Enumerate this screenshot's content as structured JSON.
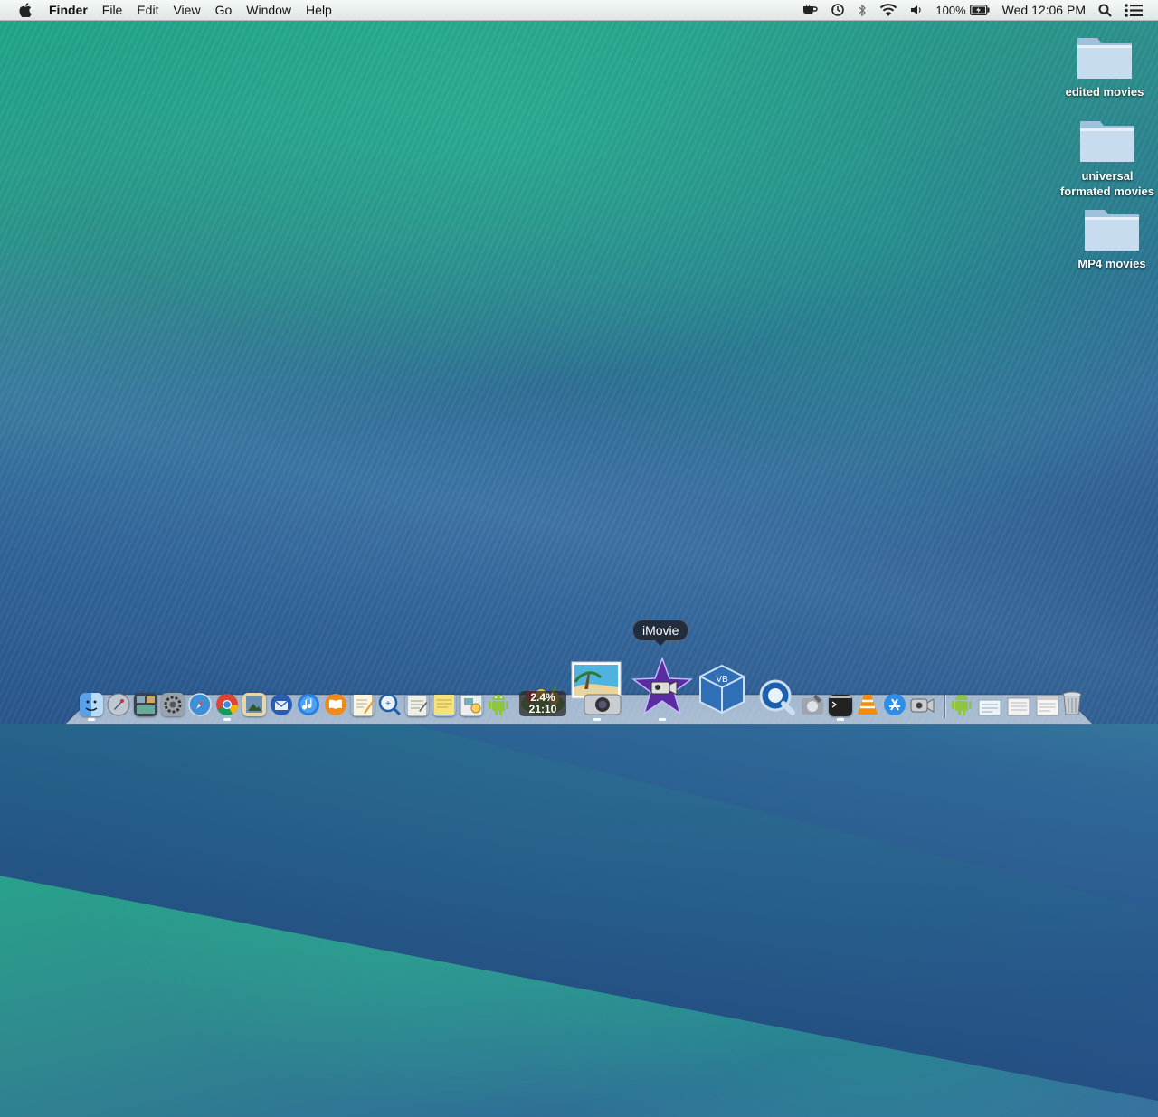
{
  "menubar": {
    "app_name": "Finder",
    "menus": [
      "File",
      "Edit",
      "View",
      "Go",
      "Window",
      "Help"
    ],
    "status": {
      "battery_percent": "100%",
      "clock": "Wed 12:06 PM"
    }
  },
  "desktop": {
    "folders": [
      {
        "label": "edited movies"
      },
      {
        "label": "universal\nformated movies"
      },
      {
        "label": "MP4 movies"
      }
    ]
  },
  "dock": {
    "tooltip": "iMovie",
    "cpu_monitor": {
      "percent": "2.4%",
      "time": "21:10"
    },
    "apps": [
      {
        "name": "finder-icon"
      },
      {
        "name": "launchpad-icon"
      },
      {
        "name": "mission-control-icon"
      },
      {
        "name": "system-preferences-icon"
      },
      {
        "name": "safari-icon"
      },
      {
        "name": "chrome-icon"
      },
      {
        "name": "preview-icon"
      },
      {
        "name": "thunderbird-icon"
      },
      {
        "name": "itunes-icon"
      },
      {
        "name": "ibooks-icon"
      },
      {
        "name": "textedit-icon"
      },
      {
        "name": "quicktime-search-icon"
      },
      {
        "name": "notes-icon"
      },
      {
        "name": "stickies-icon"
      },
      {
        "name": "preview-doc-icon"
      },
      {
        "name": "android-icon"
      },
      {
        "name": "cpu-monitor-icon"
      },
      {
        "name": "iphoto-icon"
      },
      {
        "name": "imovie-icon"
      },
      {
        "name": "virtualbox-icon"
      },
      {
        "name": "quicktime-icon"
      },
      {
        "name": "disk-utility-icon"
      },
      {
        "name": "terminal-icon"
      },
      {
        "name": "vlc-icon"
      },
      {
        "name": "app-store-icon"
      },
      {
        "name": "facetime-icon"
      },
      {
        "name": "android-file-icon"
      },
      {
        "name": "document-stack-icon"
      },
      {
        "name": "document-stack-icon-2"
      },
      {
        "name": "document-stack-icon-3"
      },
      {
        "name": "trash-icon"
      }
    ]
  }
}
